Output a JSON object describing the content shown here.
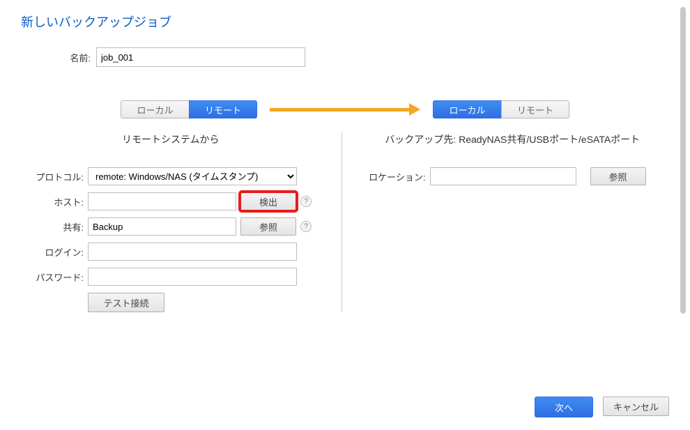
{
  "title": "新しいバックアップジョブ",
  "name_label": "名前:",
  "name_value": "job_001",
  "source": {
    "local": "ローカル",
    "remote": "リモート",
    "heading": "リモートシステムから",
    "protocol_label": "プロトコル:",
    "protocol_value": "remote: Windows/NAS (タイムスタンプ)",
    "host_label": "ホスト:",
    "host_value": "",
    "detect_btn": "検出",
    "share_label": "共有:",
    "share_value": "Backup",
    "browse_btn": "参照",
    "login_label": "ログイン:",
    "login_value": "",
    "password_label": "パスワード:",
    "password_value": "",
    "test_btn": "テスト接続",
    "help_glyph": "?"
  },
  "dest": {
    "local": "ローカル",
    "remote": "リモート",
    "heading": "バックアップ先: ReadyNAS共有/USBポート/eSATAポート",
    "location_label": "ロケーション:",
    "location_value": "",
    "browse_btn": "参照"
  },
  "footer": {
    "next": "次へ",
    "cancel": "キャンセル"
  }
}
